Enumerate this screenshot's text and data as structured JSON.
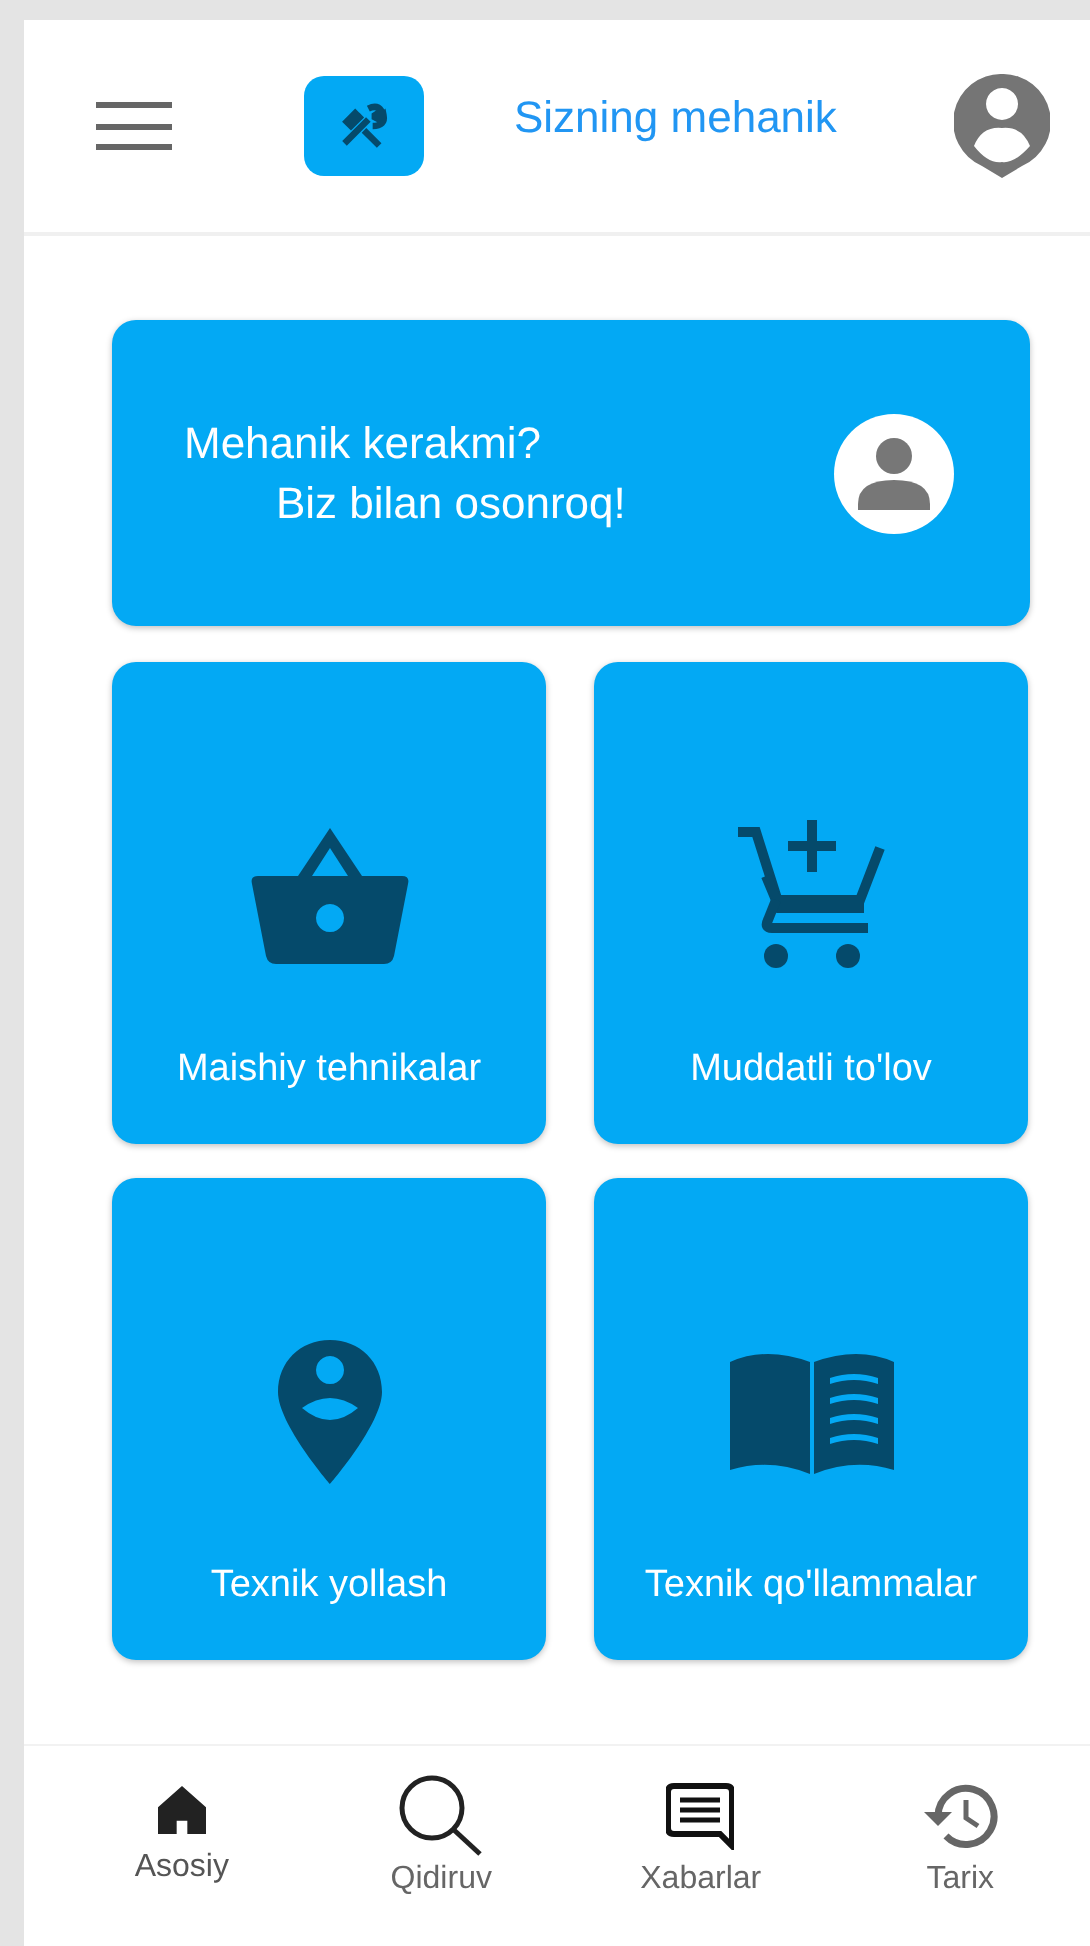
{
  "header": {
    "title": "Sizning mehanik"
  },
  "hero": {
    "line_1": "Mehanik kerakmi?",
    "line_2": "Biz bilan osonroq!"
  },
  "tiles": [
    {
      "label": "Maishiy tehnikalar"
    },
    {
      "label": "Muddatli to'lov"
    },
    {
      "label": "Texnik yollash"
    },
    {
      "label": "Texnik qo'llammalar"
    }
  ],
  "bottom_nav": [
    {
      "label": "Asosiy",
      "selected": true
    },
    {
      "label": "Qidiruv",
      "selected": false
    },
    {
      "label": "Xabarlar",
      "selected": false
    },
    {
      "label": "Tarix",
      "selected": false
    }
  ]
}
